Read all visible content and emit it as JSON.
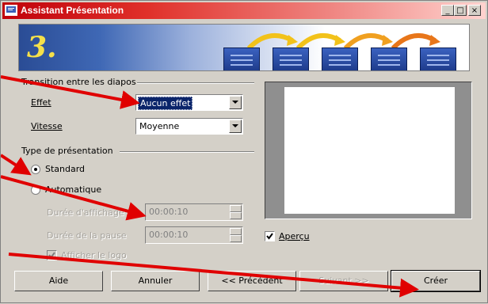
{
  "window": {
    "title": "Assistant Présentation",
    "buttons": {
      "minimize": "_",
      "maximize": "□",
      "close": "×"
    }
  },
  "banner": {
    "step": "3."
  },
  "transition_group": {
    "title": "Transition entre les diapos",
    "effect_label": "Effet",
    "effect_value": "Aucun effet",
    "speed_label": "Vitesse",
    "speed_value": "Moyenne"
  },
  "presentation_group": {
    "title": "Type de présentation",
    "standard_label": "Standard",
    "standard_checked": true,
    "auto_label": "Automatique",
    "auto_checked": false,
    "page_duration_label": "Durée d'affichage",
    "page_duration_value": "00:00:10",
    "pause_duration_label": "Durée de la pause",
    "pause_duration_value": "00:00:10",
    "show_logo_label": "Afficher le logo",
    "show_logo_checked": true
  },
  "preview": {
    "label": "Aperçu",
    "checked": true
  },
  "footer": {
    "help": "Aide",
    "cancel": "Annuler",
    "back": "<< Précédent",
    "next": "Suivant >>",
    "create": "Créer"
  },
  "colors": {
    "annotation_arrow": "#e00000",
    "selection": "#0a246a"
  }
}
